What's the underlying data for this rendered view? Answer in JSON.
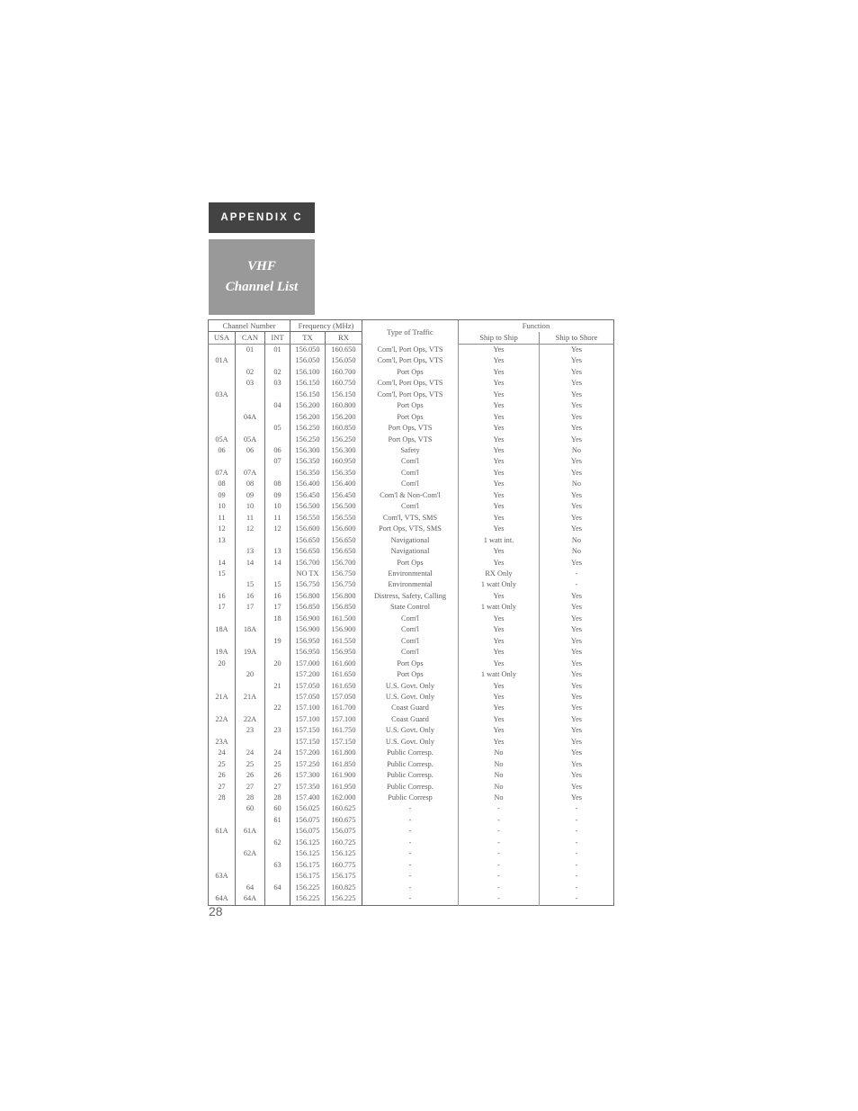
{
  "appendix": {
    "tab_label": "APPENDIX C"
  },
  "title_block": {
    "line1": "VHF",
    "line2": "Channel List"
  },
  "page_number": "28",
  "table": {
    "group_headers": {
      "channel_number": "Channel Number",
      "frequency": "Frequency (MHz)",
      "type_of_traffic": "Type of Traffic",
      "function": "Function"
    },
    "sub_headers": {
      "usa": "USA",
      "can": "CAN",
      "int": "INT",
      "tx": "TX",
      "rx": "RX",
      "ship_to_ship": "Ship to Ship",
      "ship_to_shore": "Ship to Shore"
    },
    "rows": [
      {
        "usa": "",
        "can": "01",
        "int": "01",
        "tx": "156.050",
        "rx": "160.650",
        "traffic": "Com'l, Port Ops, VTS",
        "s2s": "Yes",
        "s2sh": "Yes"
      },
      {
        "usa": "01A",
        "can": "",
        "int": "",
        "tx": "156.050",
        "rx": "156.050",
        "traffic": "Com'l, Port Ops, VTS",
        "s2s": "Yes",
        "s2sh": "Yes"
      },
      {
        "usa": "",
        "can": "02",
        "int": "02",
        "tx": "156.100",
        "rx": "160.700",
        "traffic": "Port Ops",
        "s2s": "Yes",
        "s2sh": "Yes"
      },
      {
        "usa": "",
        "can": "03",
        "int": "03",
        "tx": "156.150",
        "rx": "160.750",
        "traffic": "Com'l, Port Ops, VTS",
        "s2s": "Yes",
        "s2sh": "Yes"
      },
      {
        "usa": "03A",
        "can": "",
        "int": "",
        "tx": "156.150",
        "rx": "156.150",
        "traffic": "Com'l, Port Ops, VTS",
        "s2s": "Yes",
        "s2sh": "Yes"
      },
      {
        "usa": "",
        "can": "",
        "int": "04",
        "tx": "156.200",
        "rx": "160.800",
        "traffic": "Port Ops",
        "s2s": "Yes",
        "s2sh": "Yes"
      },
      {
        "usa": "",
        "can": "04A",
        "int": "",
        "tx": "156.200",
        "rx": "156.200",
        "traffic": "Port Ops",
        "s2s": "Yes",
        "s2sh": "Yes"
      },
      {
        "usa": "",
        "can": "",
        "int": "05",
        "tx": "156.250",
        "rx": "160.850",
        "traffic": "Port Ops, VTS",
        "s2s": "Yes",
        "s2sh": "Yes"
      },
      {
        "usa": "05A",
        "can": "05A",
        "int": "",
        "tx": "156.250",
        "rx": "156.250",
        "traffic": "Port Ops, VTS",
        "s2s": "Yes",
        "s2sh": "Yes"
      },
      {
        "usa": "06",
        "can": "06",
        "int": "06",
        "tx": "156.300",
        "rx": "156.300",
        "traffic": "Safety",
        "s2s": "Yes",
        "s2sh": "No"
      },
      {
        "usa": "",
        "can": "",
        "int": "07",
        "tx": "156.350",
        "rx": "160.950",
        "traffic": "Com'l",
        "s2s": "Yes",
        "s2sh": "Yes"
      },
      {
        "usa": "07A",
        "can": "07A",
        "int": "",
        "tx": "156.350",
        "rx": "156.350",
        "traffic": "Com'l",
        "s2s": "Yes",
        "s2sh": "Yes"
      },
      {
        "usa": "08",
        "can": "08",
        "int": "08",
        "tx": "156.400",
        "rx": "156.400",
        "traffic": "Com'l",
        "s2s": "Yes",
        "s2sh": "No"
      },
      {
        "usa": "09",
        "can": "09",
        "int": "09",
        "tx": "156.450",
        "rx": "156.450",
        "traffic": "Com'l & Non-Com'l",
        "s2s": "Yes",
        "s2sh": "Yes"
      },
      {
        "usa": "10",
        "can": "10",
        "int": "10",
        "tx": "156.500",
        "rx": "156.500",
        "traffic": "Com'l",
        "s2s": "Yes",
        "s2sh": "Yes"
      },
      {
        "usa": "11",
        "can": "11",
        "int": "11",
        "tx": "156.550",
        "rx": "156.550",
        "traffic": "Com'l, VTS, SMS",
        "s2s": "Yes",
        "s2sh": "Yes"
      },
      {
        "usa": "12",
        "can": "12",
        "int": "12",
        "tx": "156.600",
        "rx": "156.600",
        "traffic": "Port Ops, VTS, SMS",
        "s2s": "Yes",
        "s2sh": "Yes"
      },
      {
        "usa": "13",
        "can": "",
        "int": "",
        "tx": "156.650",
        "rx": "156.650",
        "traffic": "Navigational",
        "s2s": "1 watt int.",
        "s2sh": "No"
      },
      {
        "usa": "",
        "can": "13",
        "int": "13",
        "tx": "156.650",
        "rx": "156.650",
        "traffic": "Navigational",
        "s2s": "Yes",
        "s2sh": "No"
      },
      {
        "usa": "14",
        "can": "14",
        "int": "14",
        "tx": "156.700",
        "rx": "156.700",
        "traffic": "Port Ops",
        "s2s": "Yes",
        "s2sh": "Yes"
      },
      {
        "usa": "15",
        "can": "",
        "int": "",
        "tx": "NO TX",
        "rx": "156.750",
        "traffic": "Environmental",
        "s2s": "RX Only",
        "s2sh": "-"
      },
      {
        "usa": "",
        "can": "15",
        "int": "15",
        "tx": "156.750",
        "rx": "156.750",
        "traffic": "Environmental",
        "s2s": "1 watt Only",
        "s2sh": "-"
      },
      {
        "usa": "16",
        "can": "16",
        "int": "16",
        "tx": "156.800",
        "rx": "156.800",
        "traffic": "Distress, Safety, Calling",
        "s2s": "Yes",
        "s2sh": "Yes"
      },
      {
        "usa": "17",
        "can": "17",
        "int": "17",
        "tx": "156.850",
        "rx": "156.850",
        "traffic": "State Control",
        "s2s": "1 watt Only",
        "s2sh": "Yes"
      },
      {
        "usa": "",
        "can": "",
        "int": "18",
        "tx": "156.900",
        "rx": "161.500",
        "traffic": "Com'l",
        "s2s": "Yes",
        "s2sh": "Yes"
      },
      {
        "usa": "18A",
        "can": "18A",
        "int": "",
        "tx": "156.900",
        "rx": "156.900",
        "traffic": "Com'l",
        "s2s": "Yes",
        "s2sh": "Yes"
      },
      {
        "usa": "",
        "can": "",
        "int": "19",
        "tx": "156.950",
        "rx": "161.550",
        "traffic": "Com'l",
        "s2s": "Yes",
        "s2sh": "Yes"
      },
      {
        "usa": "19A",
        "can": "19A",
        "int": "",
        "tx": "156.950",
        "rx": "156.950",
        "traffic": "Com'l",
        "s2s": "Yes",
        "s2sh": "Yes"
      },
      {
        "usa": "20",
        "can": "",
        "int": "20",
        "tx": "157.000",
        "rx": "161.600",
        "traffic": "Port Ops",
        "s2s": "Yes",
        "s2sh": "Yes"
      },
      {
        "usa": "",
        "can": "20",
        "int": "",
        "tx": "157.200",
        "rx": "161.650",
        "traffic": "Port Ops",
        "s2s": "1 watt Only",
        "s2sh": "Yes"
      },
      {
        "usa": "",
        "can": "",
        "int": "21",
        "tx": "157.050",
        "rx": "161.650",
        "traffic": "U.S. Govt. Only",
        "s2s": "Yes",
        "s2sh": "Yes"
      },
      {
        "usa": "21A",
        "can": "21A",
        "int": "",
        "tx": "157.050",
        "rx": "157.050",
        "traffic": "U.S. Govt. Only",
        "s2s": "Yes",
        "s2sh": "Yes"
      },
      {
        "usa": "",
        "can": "",
        "int": "22",
        "tx": "157.100",
        "rx": "161.700",
        "traffic": "Coast Guard",
        "s2s": "Yes",
        "s2sh": "Yes"
      },
      {
        "usa": "22A",
        "can": "22A",
        "int": "",
        "tx": "157.100",
        "rx": "157.100",
        "traffic": "Coast Guard",
        "s2s": "Yes",
        "s2sh": "Yes"
      },
      {
        "usa": "",
        "can": "23",
        "int": "23",
        "tx": "157.150",
        "rx": "161.750",
        "traffic": "U.S. Govt. Only",
        "s2s": "Yes",
        "s2sh": "Yes"
      },
      {
        "usa": "23A",
        "can": "",
        "int": "",
        "tx": "157.150",
        "rx": "157.150",
        "traffic": "U.S. Govt. Only",
        "s2s": "Yes",
        "s2sh": "Yes"
      },
      {
        "usa": "24",
        "can": "24",
        "int": "24",
        "tx": "157.200",
        "rx": "161.800",
        "traffic": "Public Corresp.",
        "s2s": "No",
        "s2sh": "Yes"
      },
      {
        "usa": "25",
        "can": "25",
        "int": "25",
        "tx": "157.250",
        "rx": "161.850",
        "traffic": "Public Corresp.",
        "s2s": "No",
        "s2sh": "Yes"
      },
      {
        "usa": "26",
        "can": "26",
        "int": "26",
        "tx": "157.300",
        "rx": "161.900",
        "traffic": "Public Corresp.",
        "s2s": "No",
        "s2sh": "Yes"
      },
      {
        "usa": "27",
        "can": "27",
        "int": "27",
        "tx": "157.350",
        "rx": "161.950",
        "traffic": "Public Corresp.",
        "s2s": "No",
        "s2sh": "Yes"
      },
      {
        "usa": "28",
        "can": "28",
        "int": "28",
        "tx": "157.400",
        "rx": "162.000",
        "traffic": "Public Corresp",
        "s2s": "No",
        "s2sh": "Yes"
      },
      {
        "usa": "",
        "can": "60",
        "int": "60",
        "tx": "156.025",
        "rx": "160.625",
        "traffic": "-",
        "s2s": "-",
        "s2sh": "-"
      },
      {
        "usa": "",
        "can": "",
        "int": "61",
        "tx": "156.075",
        "rx": "160.675",
        "traffic": "-",
        "s2s": "-",
        "s2sh": "-"
      },
      {
        "usa": "61A",
        "can": "61A",
        "int": "",
        "tx": "156.075",
        "rx": "156.075",
        "traffic": "-",
        "s2s": "-",
        "s2sh": "-"
      },
      {
        "usa": "",
        "can": "",
        "int": "62",
        "tx": "156.125",
        "rx": "160.725",
        "traffic": "-",
        "s2s": "-",
        "s2sh": "-"
      },
      {
        "usa": "",
        "can": "62A",
        "int": "",
        "tx": "156.125",
        "rx": "156.125",
        "traffic": "-",
        "s2s": "-",
        "s2sh": "-"
      },
      {
        "usa": "",
        "can": "",
        "int": "63",
        "tx": "156.175",
        "rx": "160.775",
        "traffic": "-",
        "s2s": "-",
        "s2sh": "-"
      },
      {
        "usa": "63A",
        "can": "",
        "int": "",
        "tx": "156.175",
        "rx": "156.175",
        "traffic": "-",
        "s2s": "-",
        "s2sh": "-"
      },
      {
        "usa": "",
        "can": "64",
        "int": "64",
        "tx": "156.225",
        "rx": "160.825",
        "traffic": "-",
        "s2s": "-",
        "s2sh": "-"
      },
      {
        "usa": "64A",
        "can": "64A",
        "int": "",
        "tx": "156.225",
        "rx": "156.225",
        "traffic": "-",
        "s2s": "-",
        "s2sh": "-"
      }
    ]
  },
  "colors": {
    "tab_background": "#434343",
    "title_background": "#999999",
    "text": "#5a5a5a",
    "rule": "#6e6e6e"
  }
}
